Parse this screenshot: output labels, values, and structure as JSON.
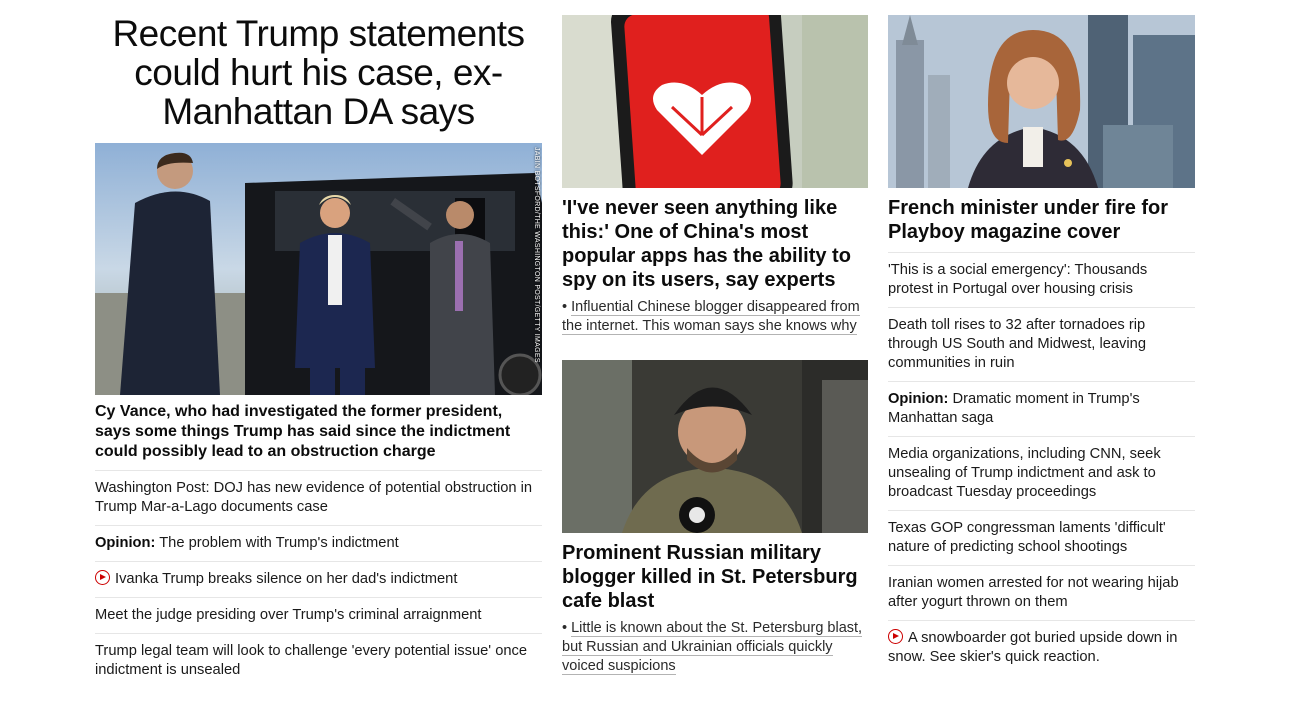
{
  "col1": {
    "headline": "Recent Trump statements could hurt his case, ex-Manhattan DA says",
    "image_credit": "JABIN BOTSFORD/THE WASHINGTON POST/GETTY IMAGES",
    "lead": "Cy Vance, who had investigated the former president, says some things Trump has said since the indictment could possibly lead to an obstruction charge",
    "items": [
      {
        "text": "Washington Post: DOJ has new evidence of potential obstruction in Trump Mar-a-Lago documents case"
      },
      {
        "prefix": "Opinion:",
        "text": " The problem with Trump's indictment"
      },
      {
        "video": true,
        "text": "Ivanka Trump breaks silence on her dad's indictment"
      },
      {
        "text": "Meet the judge presiding over Trump's criminal arraignment"
      },
      {
        "text": "Trump legal team will look to challenge 'every potential issue' once indictment is unsealed"
      }
    ]
  },
  "col2": {
    "story1": {
      "title": "'I've never seen anything like this:' One of China's most popular apps has the ability to spy on its users, say experts",
      "related": "Influential Chinese blogger disappeared from the internet. This woman says she knows why"
    },
    "story2": {
      "title": "Prominent Russian military blogger killed in St. Petersburg cafe blast",
      "related": "Little is known about the St. Petersburg blast, but Russian and Ukrainian officials quickly voiced suspicions"
    }
  },
  "col3": {
    "title": "French minister under fire for Playboy magazine cover",
    "items": [
      {
        "text": "'This is a social emergency': Thousands protest in Portugal over housing crisis"
      },
      {
        "text": "Death toll rises to 32 after tornadoes rip through US South and Midwest, leaving communities in ruin"
      },
      {
        "prefix": "Opinion:",
        "text": " Dramatic moment in Trump's Manhattan saga"
      },
      {
        "text": "Media organizations, including CNN, seek unsealing of Trump indictment and ask to broadcast Tuesday proceedings"
      },
      {
        "text": "Texas GOP congressman laments 'difficult' nature of predicting school shootings"
      },
      {
        "text": "Iranian women arrested for not wearing hijab after yogurt thrown on them"
      },
      {
        "video": true,
        "text": "A snowboarder got buried upside down in snow. See skier's quick reaction."
      }
    ]
  },
  "colors": {
    "video_icon": "#cc0000",
    "divider": "#e6e6e6",
    "text": "#0c0c0c"
  }
}
